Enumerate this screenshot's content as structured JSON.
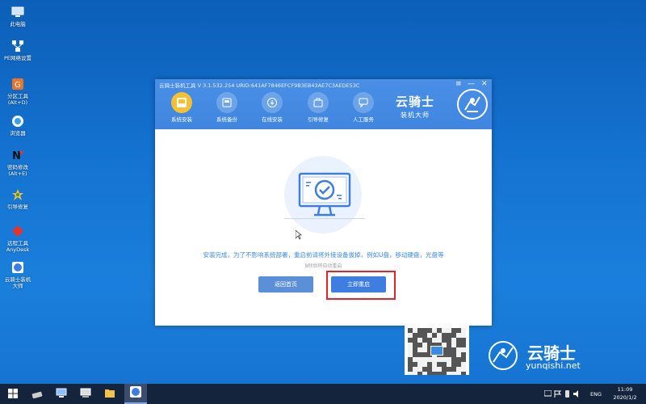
{
  "desktop": {
    "icons": [
      {
        "label": "此电脑",
        "label2": "",
        "icon": "computer-icon"
      },
      {
        "label": "PE网络设置",
        "label2": "",
        "icon": "network-icon"
      },
      {
        "label": "分区工具",
        "label2": "(Alt+D)",
        "icon": "partition-tool-icon"
      },
      {
        "label": "浏览器",
        "label2": "",
        "icon": "browser-icon"
      },
      {
        "label": "密码修改",
        "label2": "(Alt+E)",
        "icon": "password-icon"
      },
      {
        "label": "引导修复",
        "label2": "",
        "icon": "boot-repair-icon"
      },
      {
        "label": "远程工具",
        "label2": "AnyDesk",
        "icon": "anydesk-icon"
      },
      {
        "label": "云骑士装机",
        "label2": "大师",
        "icon": "yunqishi-icon"
      }
    ]
  },
  "window": {
    "title": "云骑士装机工具 V 3.1.532.254 URID:641AF7846EFCF9B3EB43AE7C3AEDE53C",
    "menu": "≡",
    "minimize": "—",
    "close": "✕",
    "nav": [
      {
        "label": "系统安装",
        "active": true
      },
      {
        "label": "系统备份",
        "active": false
      },
      {
        "label": "在线安装",
        "active": false
      },
      {
        "label": "引导修复",
        "active": false
      },
      {
        "label": "人工服务",
        "active": false
      }
    ],
    "brand_name": "云骑士",
    "brand_sub": "装机大师",
    "message": "安装完成，为了不影响系统部署，重启前请将外接设备拔掉，例如U盘，移动硬盘，光盘等",
    "countdown": "8秒后将自动重启",
    "home_button": "返回首页",
    "reboot_button": "立即重启"
  },
  "watermark": {
    "name": "云骑士",
    "url": "yunqishi.net"
  },
  "taskbar": {
    "lang": "ENG",
    "time": "11:09",
    "date": "2020/1/2"
  },
  "colors": {
    "accent": "#3d7ee0",
    "header": "#4a8fe6",
    "highlight": "#e0252a",
    "active_nav": "#f5c034"
  }
}
